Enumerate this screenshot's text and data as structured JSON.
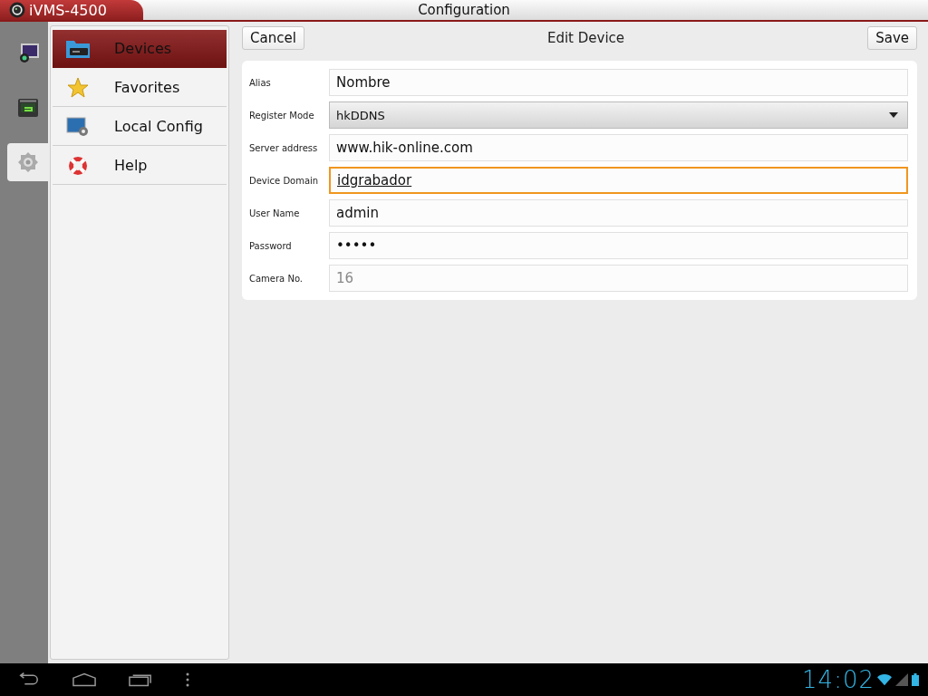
{
  "app": {
    "name": "iVMS-4500"
  },
  "title": "Configuration",
  "rail": [
    {
      "kind": "live",
      "selected": false
    },
    {
      "kind": "playback",
      "selected": false
    },
    {
      "kind": "settings",
      "selected": true
    }
  ],
  "menu": [
    {
      "kind": "devices",
      "label": "Devices",
      "selected": true
    },
    {
      "kind": "favorites",
      "label": "Favorites",
      "selected": false
    },
    {
      "kind": "local",
      "label": "Local Config",
      "selected": false
    },
    {
      "kind": "help",
      "label": "Help",
      "selected": false
    }
  ],
  "header": {
    "back": "Cancel",
    "title": "Edit Device",
    "save": "Save"
  },
  "fields": [
    {
      "kind": "text",
      "label": "Alias",
      "value": "Nombre",
      "focused": false,
      "disabled": false
    },
    {
      "kind": "select",
      "label": "Register Mode",
      "value": "hkDDNS",
      "focused": false,
      "disabled": false
    },
    {
      "kind": "text",
      "label": "Server address",
      "value": "www.hik-online.com",
      "focused": false,
      "disabled": false
    },
    {
      "kind": "text",
      "label": "Device Domain",
      "value": "idgrabador",
      "focused": true,
      "disabled": false
    },
    {
      "kind": "text",
      "label": "User Name",
      "value": "admin",
      "focused": false,
      "disabled": false
    },
    {
      "kind": "text",
      "label": "Password",
      "value": "•••••",
      "focused": false,
      "disabled": false
    },
    {
      "kind": "text",
      "label": "Camera No.",
      "value": "16",
      "focused": false,
      "disabled": true
    }
  ],
  "status": {
    "time": "14:02"
  }
}
